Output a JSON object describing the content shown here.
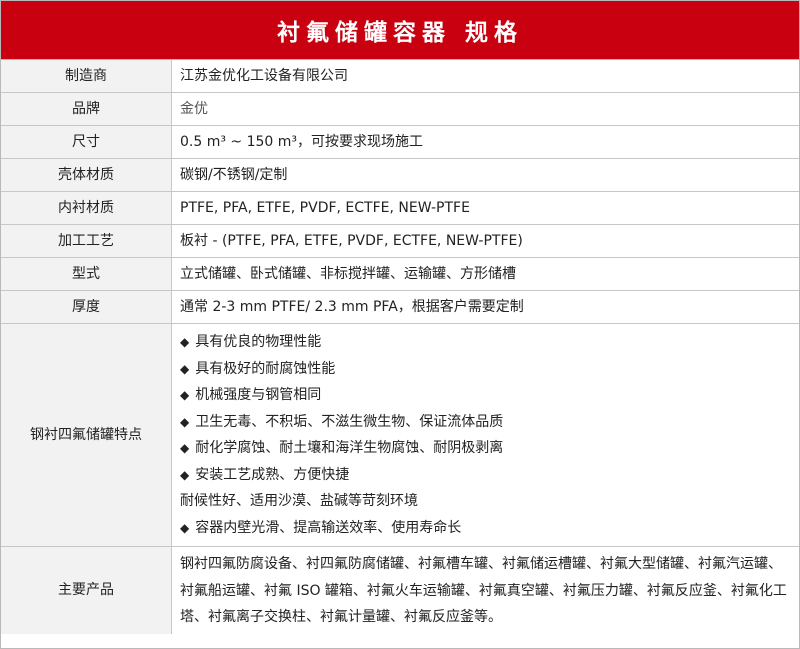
{
  "title": "衬氟储罐容器 规格",
  "rows": [
    {
      "label": "制造商",
      "value": "江苏金优化工设备有限公司"
    },
    {
      "label": "品牌",
      "value": "金优"
    },
    {
      "label": "尺寸",
      "value": "0.5 m³ ~ 150 m³，可按要求现场施工"
    },
    {
      "label": "壳体材质",
      "value": "碳钢/不锈钢/定制"
    },
    {
      "label": "内衬材质",
      "value": "PTFE, PFA, ETFE, PVDF, ECTFE, NEW-PTFE"
    },
    {
      "label": "加工工艺",
      "value": "板衬 - (PTFE, PFA, ETFE, PVDF, ECTFE, NEW-PTFE)"
    },
    {
      "label": "型式",
      "value": "立式储罐、卧式储罐、非标搅拌罐、运输罐、方形储槽"
    },
    {
      "label": "厚度",
      "value": "通常 2-3 mm PTFE/ 2.3 mm PFA，根据客户需要定制"
    }
  ],
  "features": {
    "label": "钢衬四氟储罐特点",
    "bullet": "◆",
    "items": [
      {
        "bullet": true,
        "text": "具有优良的物理性能"
      },
      {
        "bullet": true,
        "text": "具有极好的耐腐蚀性能"
      },
      {
        "bullet": true,
        "text": "机械强度与钢管相同"
      },
      {
        "bullet": true,
        "text": "卫生无毒、不积垢、不滋生微生物、保证流体品质"
      },
      {
        "bullet": true,
        "text": "耐化学腐蚀、耐土壤和海洋生物腐蚀、耐阴极剥离"
      },
      {
        "bullet": true,
        "text": "安装工艺成熟、方便快捷"
      },
      {
        "bullet": false,
        "text": "耐候性好、适用沙漠、盐碱等苛刻环境"
      },
      {
        "bullet": true,
        "text": "容器内壁光滑、提高输送效率、使用寿命长"
      }
    ]
  },
  "products": {
    "label": "主要产品",
    "text": "钢衬四氟防腐设备、衬四氟防腐储罐、衬氟槽车罐、衬氟储运槽罐、衬氟大型储罐、衬氟汽运罐、衬氟船运罐、衬氟 ISO 罐箱、衬氟火车运输罐、衬氟真空罐、衬氟压力罐、衬氟反应釜、衬氟化工塔、衬氟离子交换柱、衬氟计量罐、衬氟反应釜等。"
  },
  "colors": {
    "title_background": "#c8000f",
    "label_background": "#f2f2f2",
    "border": "#c7c7c7"
  }
}
